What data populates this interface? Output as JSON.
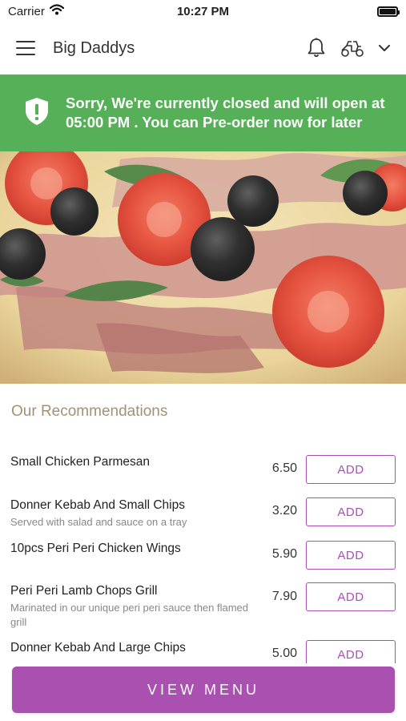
{
  "status_bar": {
    "carrier": "Carrier",
    "time": "10:27 PM"
  },
  "header": {
    "title": "Big Daddys",
    "icons": [
      "menu-icon",
      "bell-icon",
      "scooter-icon",
      "chevron-down-icon"
    ]
  },
  "banner": {
    "text": "Sorry, We're currently closed and will open at 05:00 PM . You can Pre-order now for later",
    "icon": "shield-exclamation-icon",
    "color": "#55b057"
  },
  "recommendations": {
    "title": "Our Recommendations",
    "add_label": "ADD",
    "items": [
      {
        "name": "Small Chicken Parmesan",
        "description": "",
        "price": "6.50"
      },
      {
        "name": "Donner Kebab And Small Chips",
        "description": "Served with salad and sauce on a tray",
        "price": "3.20"
      },
      {
        "name": "10pcs Peri Peri Chicken Wings",
        "description": "",
        "price": "5.90"
      },
      {
        "name": "Peri Peri Lamb Chops Grill",
        "description": "Marinated in our unique peri peri sauce then flamed grill",
        "price": "7.90"
      },
      {
        "name": "Donner Kebab And Large Chips",
        "description": "",
        "price": "5.00"
      }
    ]
  },
  "footer": {
    "view_menu_label": "VIEW MENU"
  },
  "colors": {
    "accent": "#a950b1",
    "banner": "#55b057",
    "section_title": "#a39176"
  }
}
